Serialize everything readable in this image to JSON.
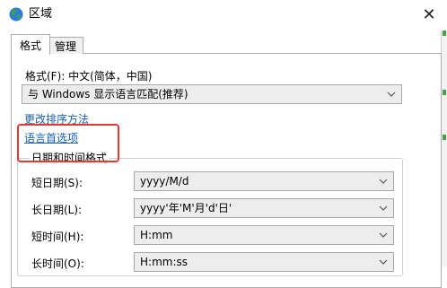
{
  "window": {
    "title": "区域",
    "close_glyph": "✕"
  },
  "tabs": [
    {
      "label": "格式"
    },
    {
      "label": "管理"
    }
  ],
  "format": {
    "label": "格式(F): 中文(简体，中国)",
    "dropdown_value": "与 Windows 显示语言匹配(推荐)"
  },
  "links": {
    "sort": "更改排序方法",
    "language": "语言首选项"
  },
  "datetime": {
    "group_title": "日期和时间格式",
    "rows": [
      {
        "label": "短日期(S):",
        "value": "yyyy/M/d"
      },
      {
        "label": "长日期(L):",
        "value": "yyyy'年'M'月'd'日'"
      },
      {
        "label": "短时间(H):",
        "value": "H:mm"
      },
      {
        "label": "长时间(O):",
        "value": "H:mm:ss"
      }
    ]
  },
  "colors": {
    "link": "#1a5fb4",
    "highlight": "#e53935",
    "globe_blue": "#2f7dd1",
    "globe_green": "#3fa34d"
  },
  "icons": {
    "window": "globe-icon",
    "close": "close-icon",
    "dropdown": "chevron-down-icon"
  }
}
